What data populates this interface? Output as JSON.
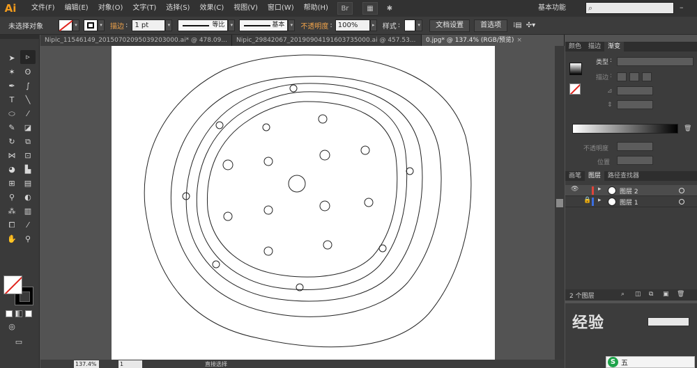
{
  "app": {
    "logo_text": "Ai",
    "accent": "#f29b1d"
  },
  "menu": {
    "items": [
      "文件(F)",
      "编辑(E)",
      "对象(O)",
      "文字(T)",
      "选择(S)",
      "效果(C)",
      "视图(V)",
      "窗口(W)",
      "帮助(H)"
    ]
  },
  "workspace": {
    "label": "基本功能",
    "search_placeholder": ""
  },
  "control": {
    "selection_status": "未选择对象",
    "stroke_label": "描边",
    "stroke_weight": "1 pt",
    "profile_label": "等比",
    "brush_label": "基本",
    "opacity_label": "不透明度",
    "opacity_value": "100%",
    "style_label": "样式",
    "doc_setup_button": "文档设置",
    "prefs_button": "首选项"
  },
  "tabs": [
    {
      "label": "Nipic_11546149_20150702095039203000.ai* @ 478.09..."
    },
    {
      "label": "Nipic_29842067_20190904191603735000.ai @ 457.53..."
    },
    {
      "label": "0.jpg* @ 137.4% (RGB/预览)"
    }
  ],
  "status": {
    "zoom": "137.4%",
    "page": "1",
    "tool_text": "直接选择"
  },
  "gradient_panel": {
    "tabs": [
      "颜色",
      "描边",
      "渐变"
    ],
    "type_label": "类型",
    "stroke_label": "描边",
    "opacity_label": "不透明度",
    "position_label": "位置"
  },
  "layers_panel": {
    "tabs": [
      "画笔",
      "图层",
      "路径查找器"
    ],
    "layers": [
      {
        "name": "图层 2",
        "color": "#e0443a",
        "selected": true
      },
      {
        "name": "图层 1",
        "color": "#3a6ee0",
        "selected": false
      }
    ],
    "count_label": "2 个图层"
  },
  "overlay": {
    "watermark": "经验",
    "ime_label": "五"
  },
  "icons": {
    "selection": "selection-tool-icon",
    "direct": "direct-selection-tool-icon",
    "pen": "pen-tool-icon",
    "type": "type-tool-icon",
    "hand": "hand-tool-icon",
    "zoom": "zoom-tool-icon"
  }
}
